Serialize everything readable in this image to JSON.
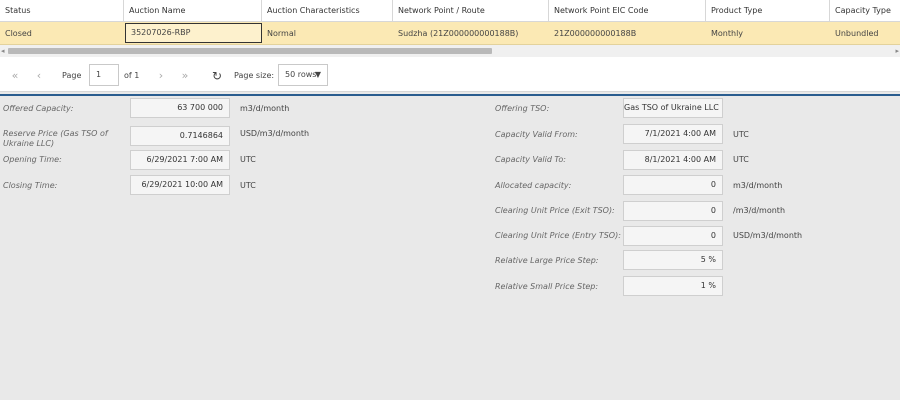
{
  "grid": {
    "columns": [
      "Status",
      "Auction Name",
      "Auction Characteristics",
      "Network Point / Route",
      "Network Point EIC Code",
      "Product Type",
      "Capacity Type"
    ],
    "rows": [
      [
        "Closed",
        "35207026-RBP",
        "Normal",
        "Sudzha (21Z000000000188B)",
        "21Z000000000188B",
        "Monthly",
        "Unbundled"
      ]
    ]
  },
  "pager": {
    "page_label": "Page",
    "page_value": "1",
    "of_label": "of 1",
    "page_size_label": "Page size:",
    "page_size_value": "50 rows"
  },
  "form": {
    "left": [
      {
        "label": "Offered Capacity:",
        "value": "63 700 000",
        "unit": "m3/d/month"
      },
      {
        "label": "Reserve Price (Gas TSO of Ukraine LLC)",
        "value": "0.7146864",
        "unit": "USD/m3/d/month"
      },
      {
        "label": "Opening Time:",
        "value": "6/29/2021 7:00 AM",
        "unit": "UTC"
      },
      {
        "label": "Closing Time:",
        "value": "6/29/2021 10:00 AM",
        "unit": "UTC"
      }
    ],
    "right": [
      {
        "label": "Offering TSO:",
        "value": "Gas TSO of Ukraine LLC",
        "unit": ""
      },
      {
        "label": "Capacity Valid From:",
        "value": "7/1/2021 4:00 AM",
        "unit": "UTC"
      },
      {
        "label": "Capacity Valid To:",
        "value": "8/1/2021 4:00 AM",
        "unit": "UTC"
      },
      {
        "label": "Allocated capacity:",
        "value": "0",
        "unit": "m3/d/month"
      },
      {
        "label": "Clearing Unit Price (Exit TSO):",
        "value": "0",
        "unit": "/m3/d/month"
      },
      {
        "label": "Clearing Unit Price (Entry TSO):",
        "value": "0",
        "unit": "USD/m3/d/month"
      },
      {
        "label": "Relative Large Price Step:",
        "value": "5 %",
        "unit": ""
      },
      {
        "label": "Relative Small Price Step:",
        "value": "1 %",
        "unit": ""
      }
    ]
  },
  "icons": {
    "first": "first-page-icon",
    "prev": "prev-page-icon",
    "next": "next-page-icon",
    "last": "last-page-icon",
    "refresh": "refresh-icon"
  },
  "colors": {
    "selected_row": "#fbe9b4",
    "accent_line": "#2a5d8f"
  }
}
